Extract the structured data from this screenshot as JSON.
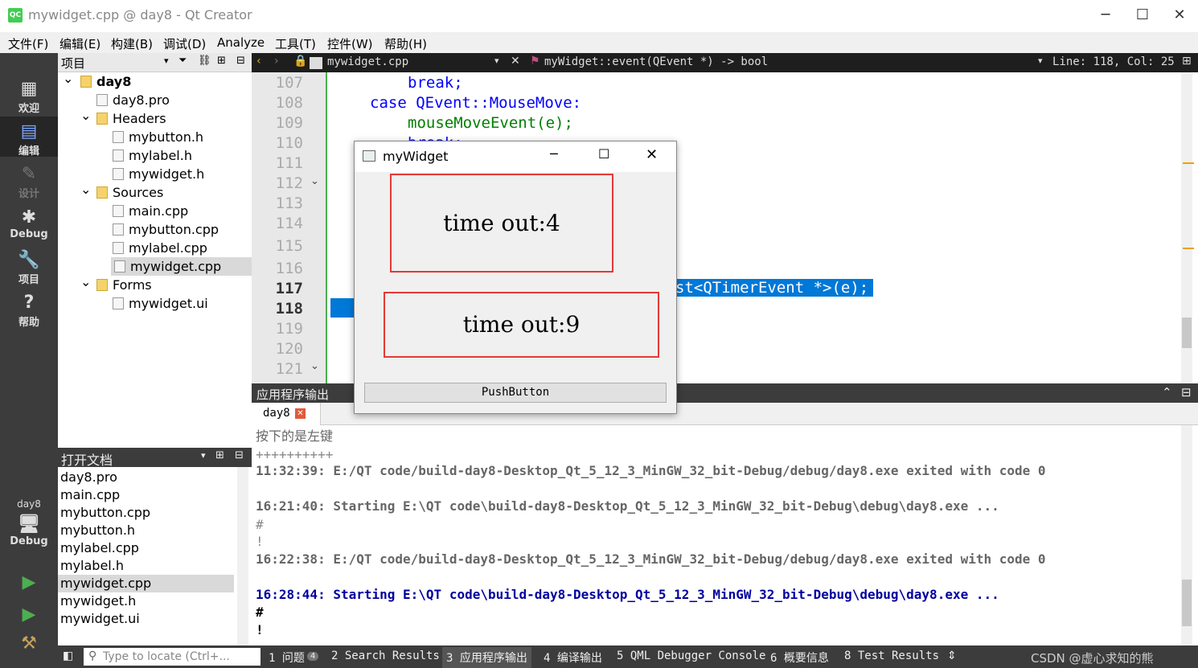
{
  "window": {
    "title": "mywidget.cpp @ day8 - Qt Creator",
    "logo": "QC"
  },
  "menu": [
    "文件(F)",
    "编辑(E)",
    "构建(B)",
    "调试(D)",
    "Analyze",
    "工具(T)",
    "控件(W)",
    "帮助(H)"
  ],
  "project_pane": {
    "title": "项目"
  },
  "editor_bar": {
    "file": "mywidget.cpp",
    "function": "myWidget::event(QEvent *) -> bool",
    "position": "Line: 118, Col: 25"
  },
  "modes": [
    {
      "label": "欢迎",
      "icon": "grid-icon"
    },
    {
      "label": "编辑",
      "icon": "edit-icon"
    },
    {
      "label": "设计",
      "icon": "pencil-icon"
    },
    {
      "label": "Debug",
      "icon": "bug-icon"
    },
    {
      "label": "项目",
      "icon": "wrench-icon"
    },
    {
      "label": "帮助",
      "icon": "help-icon"
    }
  ],
  "target": {
    "project": "day8",
    "config": "Debug"
  },
  "tree": [
    {
      "label": "day8",
      "level": 0,
      "bold": true
    },
    {
      "label": "day8.pro",
      "level": 1
    },
    {
      "label": "Headers",
      "level": 1
    },
    {
      "label": "mybutton.h",
      "level": 2
    },
    {
      "label": "mylabel.h",
      "level": 2
    },
    {
      "label": "mywidget.h",
      "level": 2
    },
    {
      "label": "Sources",
      "level": 1
    },
    {
      "label": "main.cpp",
      "level": 2
    },
    {
      "label": "mybutton.cpp",
      "level": 2
    },
    {
      "label": "mylabel.cpp",
      "level": 2
    },
    {
      "label": "mywidget.cpp",
      "level": 2,
      "selected": true
    },
    {
      "label": "Forms",
      "level": 1
    },
    {
      "label": "mywidget.ui",
      "level": 2
    }
  ],
  "open_docs": {
    "title": "打开文档",
    "items": [
      "day8.pro",
      "main.cpp",
      "mybutton.cpp",
      "mybutton.h",
      "mylabel.cpp",
      "mylabel.h",
      "mywidget.cpp",
      "mywidget.h",
      "mywidget.ui"
    ]
  },
  "lines": [
    "107",
    "108",
    "109",
    "110",
    "111",
    "112",
    "113",
    "114",
    "115",
    "116",
    "117",
    "118",
    "119",
    "120",
    "121"
  ],
  "code": {
    "l107": "break;",
    "l108": "case QEvent::MouseMove:",
    "l109": "mouseMoveEvent(e);",
    "l110": "break;",
    "l117_tail": "st<QTimerEvent *>(e);"
  },
  "widget": {
    "title": "myWidget",
    "label1": "time out:4",
    "label2": "time out:9",
    "button": "PushButton"
  },
  "output": {
    "title": "应用程序输出",
    "tab": "day8",
    "lines": [
      "按下的是左键",
      "++++++++++",
      "11:32:39: E:/QT code/build-day8-Desktop_Qt_5_12_3_MinGW_32_bit-Debug/debug/day8.exe exited with code 0",
      "",
      "16:21:40: Starting E:\\QT code\\build-day8-Desktop_Qt_5_12_3_MinGW_32_bit-Debug\\debug\\day8.exe ...",
      "#",
      "!",
      "16:22:38: E:/QT code/build-day8-Desktop_Qt_5_12_3_MinGW_32_bit-Debug/debug/day8.exe exited with code 0",
      "",
      "16:28:44: Starting E:\\QT code\\build-day8-Desktop_Qt_5_12_3_MinGW_32_bit-Debug\\debug\\day8.exe ...",
      "#",
      "!"
    ]
  },
  "status": {
    "locate_placeholder": "Type to locate (Ctrl+...",
    "tabs": [
      "1 问题",
      "2 Search Results",
      "3 应用程序输出",
      "4 编译输出",
      "5 QML Debugger Console",
      "6 概要信息",
      "8 Test Results"
    ],
    "issues_count": "4"
  },
  "watermark": "CSDN @虚心求知的熊"
}
